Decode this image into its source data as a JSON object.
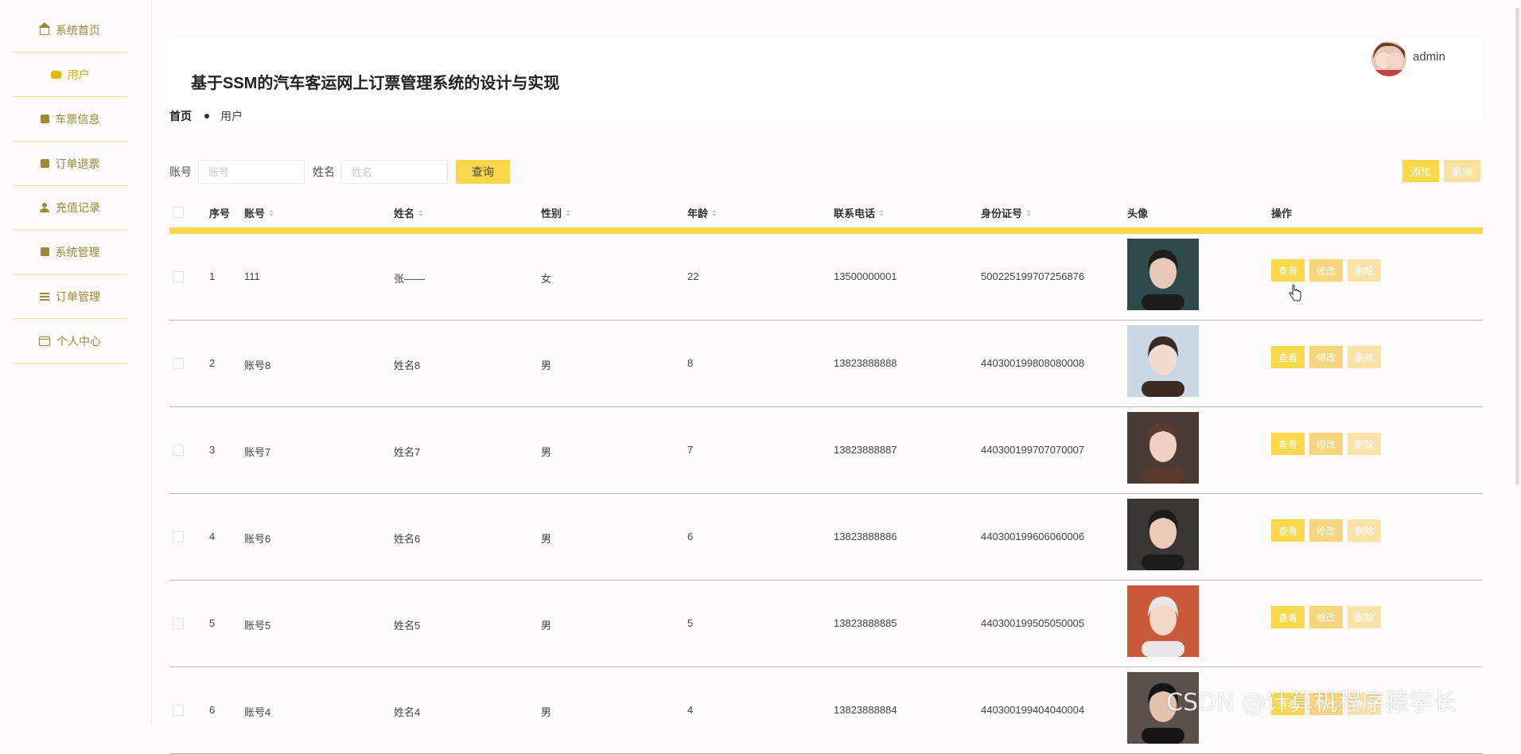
{
  "sidebar": {
    "items": [
      {
        "label": "系统首页",
        "icon": "home-icon"
      },
      {
        "label": "用户",
        "icon": "chat-icon"
      },
      {
        "label": "车票信息",
        "icon": "ticket-icon"
      },
      {
        "label": "订单退票",
        "icon": "clipboard-icon"
      },
      {
        "label": "充值记录",
        "icon": "user-icon"
      },
      {
        "label": "系统管理",
        "icon": "clipboard-icon"
      },
      {
        "label": "订单管理",
        "icon": "list-icon"
      },
      {
        "label": "个人中心",
        "icon": "card-icon"
      }
    ]
  },
  "header": {
    "title": "基于SSM的汽车客运网上订票管理系统的设计与实现",
    "username": "admin"
  },
  "breadcrumb": {
    "home": "首页",
    "current": "用户"
  },
  "search": {
    "account_label": "账号",
    "account_placeholder": "账号",
    "name_label": "姓名",
    "name_placeholder": "姓名",
    "query_label": "查询"
  },
  "toolbar": {
    "add_label": "添加",
    "delete_label": "删除"
  },
  "table": {
    "headers": {
      "index": "序号",
      "account": "账号",
      "name": "姓名",
      "gender": "性别",
      "age": "年龄",
      "phone": "联系电话",
      "idcard": "身份证号",
      "avatar": "头像",
      "actions": "操作"
    },
    "rows": [
      {
        "index": "1",
        "account": "111",
        "name": "张——",
        "gender": "女",
        "age": "22",
        "phone": "13500000001",
        "idcard": "500225199707256876"
      },
      {
        "index": "2",
        "account": "账号8",
        "name": "姓名8",
        "gender": "男",
        "age": "8",
        "phone": "13823888888",
        "idcard": "440300199808080008"
      },
      {
        "index": "3",
        "account": "账号7",
        "name": "姓名7",
        "gender": "男",
        "age": "7",
        "phone": "13823888887",
        "idcard": "440300199707070007"
      },
      {
        "index": "4",
        "account": "账号6",
        "name": "姓名6",
        "gender": "男",
        "age": "6",
        "phone": "13823888886",
        "idcard": "440300199606060006"
      },
      {
        "index": "5",
        "account": "账号5",
        "name": "姓名5",
        "gender": "男",
        "age": "5",
        "phone": "13823888885",
        "idcard": "440300199505050005"
      },
      {
        "index": "6",
        "account": "账号4",
        "name": "姓名4",
        "gender": "男",
        "age": "4",
        "phone": "13823888884",
        "idcard": "440300199404040004"
      }
    ],
    "actions": {
      "view": "查看",
      "edit": "修改",
      "delete": "删除"
    }
  },
  "watermark": "CSDN @计算机程序猿学长",
  "colors": {
    "accent": "#fcd84a",
    "accent_light": "#f9e3a8",
    "sidebar_text": "#9a8a3a",
    "active_text": "#e2b800"
  }
}
